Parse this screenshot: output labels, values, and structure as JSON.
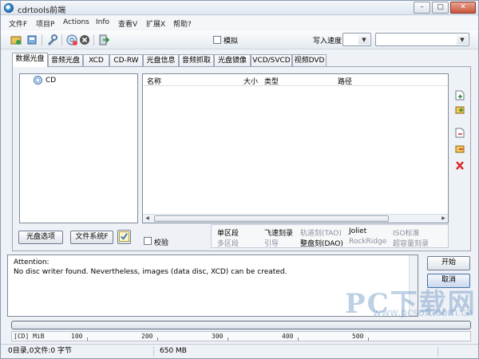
{
  "window": {
    "title": "cdrtools前端",
    "controls": [
      "–",
      "▢",
      "✕"
    ]
  },
  "menu": [
    "文件F",
    "项目P",
    "Actions",
    "Info",
    "查看V",
    "扩展X",
    "帮助?"
  ],
  "toolbar": {
    "simulate_label": "模拟",
    "write_speed_label": "写入速度"
  },
  "tabs": [
    "数据光盘",
    "音频光盘",
    "XCD",
    "CD-RW",
    "光盘信息",
    "音频抓取",
    "光盘镜像",
    "VCD/SVCD",
    "视频DVD"
  ],
  "active_tab": "数据光盘",
  "tree": {
    "root": "CD"
  },
  "filelist": {
    "columns": [
      "名称",
      "大小",
      "类型",
      "路径"
    ]
  },
  "buttons": {
    "disc_options": "光盘选项",
    "filesystem": "文件系统F",
    "verify": "校验",
    "start": "开始",
    "cancel": "取消"
  },
  "modes": {
    "row1": [
      "单区段",
      "飞速刻录",
      "轨道刻(TAO)",
      "Joliet",
      "ISO标准"
    ],
    "row2": [
      "多区段",
      "引导",
      "整盘刻(DAO)",
      "RockRidge",
      "超容量刻录"
    ]
  },
  "log": [
    "Attention:",
    "No disc writer found. Nevertheless, images (data disc, XCD) can be created."
  ],
  "ruler": {
    "unit": "[CD] MiB",
    "marks": [
      "100",
      "200",
      "300",
      "400",
      "500"
    ]
  },
  "status": {
    "files": "0目录,0文件:0 字节",
    "capacity": "650 MB"
  },
  "watermark": {
    "main": "PC下载网",
    "url": "www.pcsoft.com.cn"
  },
  "colors": {
    "accent": "#3f6fa7",
    "window_bg": "#eef1f6"
  }
}
